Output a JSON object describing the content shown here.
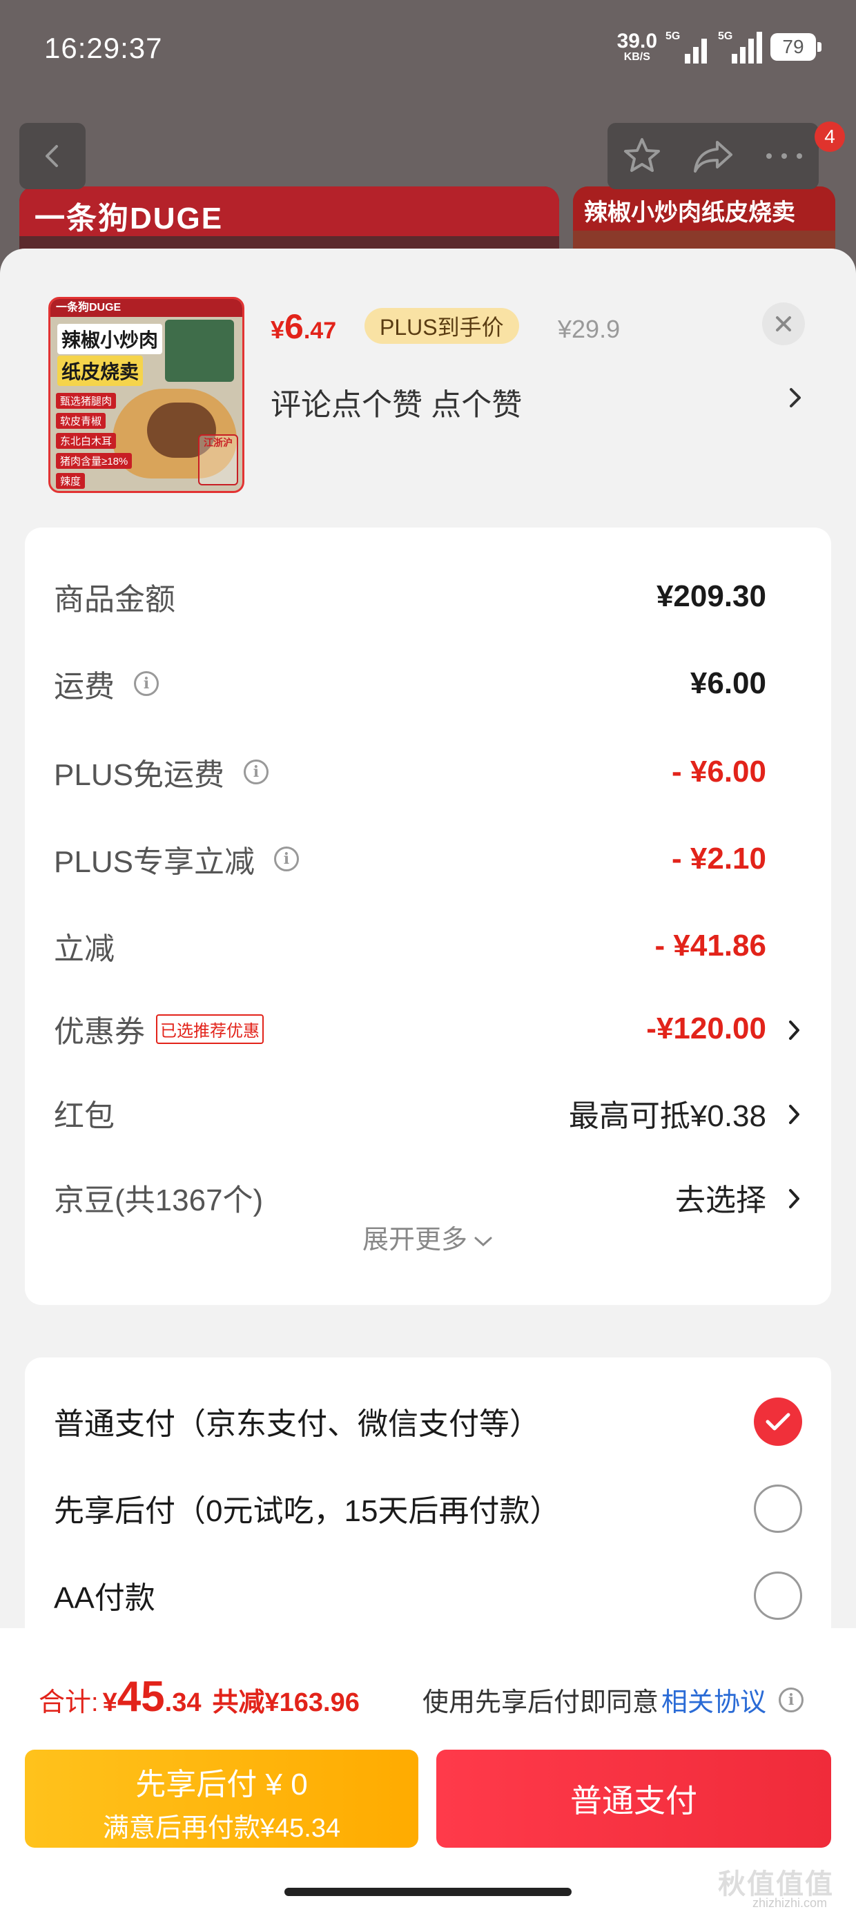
{
  "status_bar": {
    "time": "16:29:37",
    "net_speed": "39.0",
    "net_unit": "KB/S",
    "sim1": "5G",
    "sim2": "5G",
    "battery": "79"
  },
  "background_page": {
    "brand_text": "一条狗DUGE",
    "banner_right_text": "辣椒小炒肉纸皮烧卖",
    "cart_badge": "4",
    "icons": [
      "back-icon",
      "star-icon",
      "share-icon",
      "more-icon"
    ]
  },
  "product": {
    "price_symbol": "¥",
    "price_int": "6",
    "price_dec": ".47",
    "plus_badge": "PLUS到手价",
    "original_price": "¥29.9",
    "title": "评论点个赞  点个赞",
    "thumb": {
      "top_text": "一条狗DUGE",
      "name_line1": "辣椒小炒肉",
      "name_line2": "纸皮烧卖",
      "features": [
        "甄选猪腿肉",
        "软皮青椒",
        "东北白木耳",
        "猪肉含量≥18%",
        "辣度"
      ],
      "stamp": "江浙沪"
    }
  },
  "price_details": [
    {
      "label": "商品金额",
      "value": "¥209.30",
      "style": "normal",
      "info": false,
      "chevron": false
    },
    {
      "label": "运费",
      "value": "¥6.00",
      "style": "normal",
      "info": true,
      "chevron": false
    },
    {
      "label": "PLUS免运费",
      "value": "- ¥6.00",
      "style": "red",
      "info": true,
      "chevron": false
    },
    {
      "label": "PLUS专享立减",
      "value": "- ¥2.10",
      "style": "red",
      "info": true,
      "chevron": false
    },
    {
      "label": "立减",
      "value": "- ¥41.86",
      "style": "red",
      "info": false,
      "chevron": false
    },
    {
      "label": "优惠券",
      "tag": "已选推荐优惠",
      "value": "-¥120.00",
      "style": "red",
      "info": false,
      "chevron": true
    },
    {
      "label": "红包",
      "value": "最高可抵¥0.38",
      "style": "plain",
      "info": false,
      "chevron": true
    },
    {
      "label": "京豆(共1367个)",
      "value": "去选择",
      "style": "plain",
      "info": false,
      "chevron": true
    }
  ],
  "expand_more": "展开更多",
  "payment_options": [
    {
      "label": "普通支付（京东支付、微信支付等）",
      "checked": true
    },
    {
      "label": "先享后付（0元试吃，15天后再付款）",
      "checked": false
    },
    {
      "label": "AA付款",
      "checked": false
    }
  ],
  "footer": {
    "total_label": "合计:",
    "total_symbol": "¥",
    "total_int": "45",
    "total_dec": ".34",
    "total_saved": "共减¥163.96",
    "agree_prefix": "使用先享后付即同意",
    "agree_link": "相关协议",
    "btn_later_line1": "先享后付 ¥ 0",
    "btn_later_line2": "满意后再付款¥45.34",
    "btn_pay": "普通支付"
  },
  "watermark": {
    "main": "秋值值值",
    "sub": "zhizhizhi.com"
  },
  "colors": {
    "accent_red": "#e2231a",
    "pay_red": "#f0303a",
    "later_yellow": "#ffb300",
    "link_blue": "#2a6bd6"
  }
}
